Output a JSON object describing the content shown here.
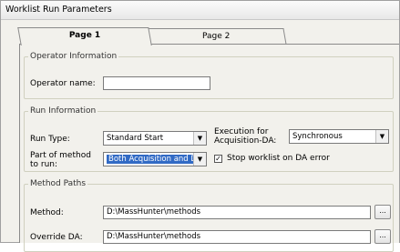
{
  "window": {
    "title": "Worklist Run Parameters"
  },
  "tabs": [
    {
      "label": "Page 1",
      "active": true
    },
    {
      "label": "Page 2",
      "active": false
    }
  ],
  "operator_information": {
    "legend": "Operator Information",
    "operator_name_label": "Operator name:",
    "operator_name_value": ""
  },
  "run_information": {
    "legend": "Run Information",
    "run_type_label": "Run Type:",
    "run_type_value": "Standard Start",
    "execution_label": "Execution for Acquisition-DA:",
    "execution_value": "Synchronous",
    "part_of_method_label": "Part of method to run:",
    "part_of_method_value": "Both Acquisition and DA",
    "stop_on_error_label": "Stop worklist on DA error",
    "stop_on_error_checked": "✓"
  },
  "method_paths": {
    "legend": "Method Paths",
    "method_label": "Method:",
    "method_value": "D:\\MassHunter\\methods",
    "override_da_label": "Override DA:",
    "override_da_value": "D:\\MassHunter\\methods",
    "browse_label": "..."
  },
  "icons": {
    "dropdown": "chevron-down-icon",
    "dropdown_glyph": "▼"
  }
}
